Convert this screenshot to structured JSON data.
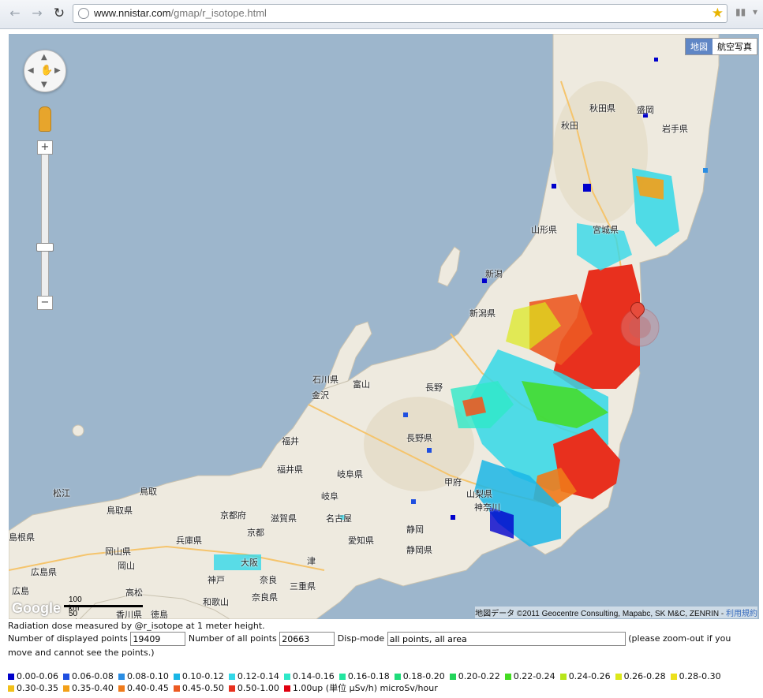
{
  "browser": {
    "url_host": "www.nnistar.com",
    "url_path": "/gmap/r_isotope.html"
  },
  "map": {
    "type_map": "地図",
    "type_satellite": "航空写真",
    "scale_km": "100 km",
    "scale_mi": "50 mi",
    "logo": "Google",
    "copyright": "地図データ ©2011 Geocentre Consulting, Mapabc, SK M&C, ZENRIN - ",
    "terms": "利用規約",
    "labels": {
      "akita_ken": "秋田県",
      "morioka": "盛岡",
      "akita": "秋田",
      "iwate_ken": "岩手県",
      "yamagata_ken": "山形県",
      "miyagi_ken": "宮城県",
      "niigata": "新潟",
      "niigata_ken": "新潟県",
      "ishikawa_ken": "石川県",
      "toyama": "富山",
      "kanazawa": "金沢",
      "nagano": "長野",
      "fukui": "福井",
      "nagano_ken": "長野県",
      "fukui_ken": "福井県",
      "gifu_ken": "岐阜県",
      "yamanashi_ken": "山梨県",
      "kanagawa_ken": "神奈川",
      "matsue": "松江",
      "tottori": "鳥取",
      "tottori_ken": "鳥取県",
      "kyoto_fu": "京都府",
      "shiga_ken": "滋賀県",
      "gifu": "岐阜",
      "nagoya": "名古屋",
      "shizuoka": "静岡",
      "shimane_ken": "島根県",
      "okayama_ken": "岡山県",
      "hyogo_ken": "兵庫県",
      "kyoto": "京都",
      "aichi_ken": "愛知県",
      "shizuoka_ken": "静岡県",
      "okayama": "岡山",
      "osaka": "大阪",
      "tsu": "津",
      "hiroshima_ken": "広島県",
      "kobe": "神戸",
      "nara": "奈良",
      "mie_ken": "三重県",
      "hiroshima": "広島",
      "takamatsu": "高松",
      "nara_ken": "奈良県",
      "wakayama": "和歌山",
      "tokushima": "徳島",
      "kagawa_ken": "香川県",
      "kofu": "甲府"
    }
  },
  "info": {
    "note": "Radiation dose measured by @r_isotope at 1 meter height.",
    "displayed_label": "Number of displayed points",
    "displayed_value": "19409",
    "all_label": "Number of all points",
    "all_value": "20663",
    "mode_label": "Disp-mode",
    "mode_value": "all points, all area",
    "hint": "(please zoom-out if you move and cannot see the points.)"
  },
  "legend": {
    "items": [
      {
        "label": "0.00-0.06",
        "color": "#0000cc"
      },
      {
        "label": "0.06-0.08",
        "color": "#1f4fe0"
      },
      {
        "label": "0.08-0.10",
        "color": "#2a8de3"
      },
      {
        "label": "0.10-0.12",
        "color": "#1ab6e6"
      },
      {
        "label": "0.12-0.14",
        "color": "#33d8e8"
      },
      {
        "label": "0.14-0.16",
        "color": "#2ee8c8"
      },
      {
        "label": "0.16-0.18",
        "color": "#22e6a0"
      },
      {
        "label": "0.18-0.20",
        "color": "#1edc7a"
      },
      {
        "label": "0.20-0.22",
        "color": "#22d45a"
      },
      {
        "label": "0.22-0.24",
        "color": "#44dc22"
      },
      {
        "label": "0.24-0.26",
        "color": "#b8e61a"
      },
      {
        "label": "0.26-0.28",
        "color": "#dce81a"
      },
      {
        "label": "0.28-0.30",
        "color": "#ece01c"
      },
      {
        "label": "0.30-0.35",
        "color": "#f2c018"
      },
      {
        "label": "0.35-0.40",
        "color": "#f3a018"
      },
      {
        "label": "0.40-0.45",
        "color": "#ef7a1a"
      },
      {
        "label": "0.45-0.50",
        "color": "#ec5a22"
      },
      {
        "label": "0.50-1.00",
        "color": "#e8301e"
      },
      {
        "label": "1.00up (単位 μSv/h) microSv/hour",
        "color": "#e00010"
      }
    ]
  }
}
